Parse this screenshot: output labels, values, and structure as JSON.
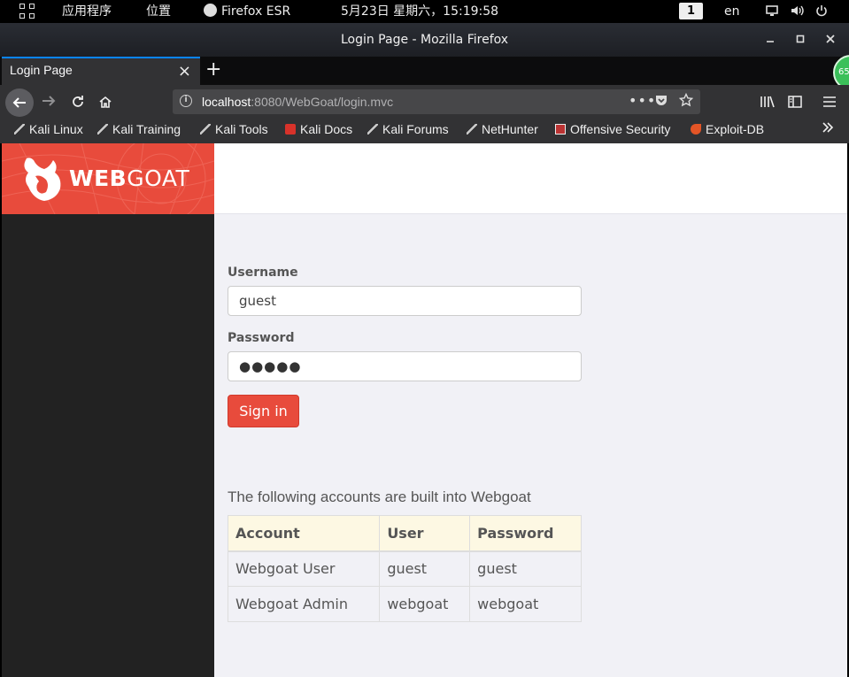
{
  "panel": {
    "apps_label": "应用程序",
    "places_label": "位置",
    "active_app": "Firefox ESR",
    "clock": "5月23日 星期六，15:19:58",
    "workspace": "1",
    "language": "en"
  },
  "window": {
    "title": "Login Page - Mozilla Firefox"
  },
  "tabs": [
    {
      "label": "Login Page",
      "active": true
    }
  ],
  "badge": {
    "text": "65"
  },
  "urlbar": {
    "host": "localhost",
    "rest": ":8080/WebGoat/login.mvc"
  },
  "bookmarks": [
    {
      "label": "Kali Linux",
      "icon": "kali-dragon-icon"
    },
    {
      "label": "Kali Training",
      "icon": "kali-dragon-icon"
    },
    {
      "label": "Kali Tools",
      "icon": "kali-dragon-icon"
    },
    {
      "label": "Kali Docs",
      "icon": "kali-docs-icon"
    },
    {
      "label": "Kali Forums",
      "icon": "kali-dragon-icon"
    },
    {
      "label": "NetHunter",
      "icon": "nethunter-icon"
    },
    {
      "label": "Offensive Security",
      "icon": "offsec-icon"
    },
    {
      "label": "Exploit-DB",
      "icon": "exploit-db-icon"
    }
  ],
  "brand": {
    "bold": "WEB",
    "light": "GOAT"
  },
  "login": {
    "username_label": "Username",
    "username_value": "guest",
    "password_label": "Password",
    "password_dots": "●●●●●",
    "signin_label": "Sign in"
  },
  "accounts": {
    "intro": "The following accounts are built into Webgoat",
    "headers": [
      "Account",
      "User",
      "Password"
    ],
    "rows": [
      [
        "Webgoat User",
        "guest",
        "guest"
      ],
      [
        "Webgoat Admin",
        "webgoat",
        "webgoat"
      ]
    ]
  },
  "colors": {
    "accent": "#e84b3c",
    "sidebar": "#222222",
    "page_bg": "#f1f1f6",
    "table_header": "#fdf8e3",
    "firefox_chrome": "#323234"
  }
}
